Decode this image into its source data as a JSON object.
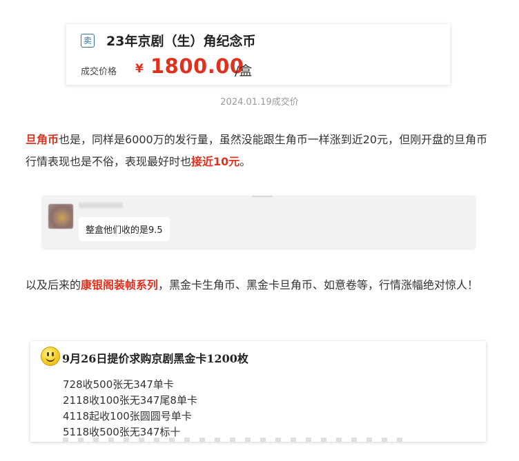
{
  "price_card": {
    "tag": "卖",
    "title": "23年京剧（生）角纪念币",
    "price_label": "成交价格",
    "currency": "¥",
    "price": "1800.00",
    "unit": "/盒",
    "deal_date": "2024.01.19成交价"
  },
  "article": {
    "para1": {
      "hl1": "旦角币",
      "text1": "也是，同样是6000万的发行量，虽然没能跟生角币一样涨到近20元，但刚开盘的旦角币行情表现也是不俗，表现最好时也",
      "hl2": "接近10元",
      "text2": "。"
    },
    "para2": {
      "text1": "以及后来的",
      "hl1": "康银阁装帧系列",
      "text2": "，黑金卡生角币、黑金卡旦角币、如意卷等，行情涨幅绝对惊人！"
    }
  },
  "chat": {
    "message": "整盒他们收的是9.5"
  },
  "offer": {
    "title": "9月26日提价求购京剧黑金卡1200枚",
    "items": [
      "728收500张无347单卡",
      "2118收100张无347尾8单卡",
      "4118起收100张圆圆号单卡",
      "5118收500张无347标十"
    ]
  },
  "colors": {
    "accent_red": "#e0301e",
    "tag_blue": "#2f6fb0"
  }
}
